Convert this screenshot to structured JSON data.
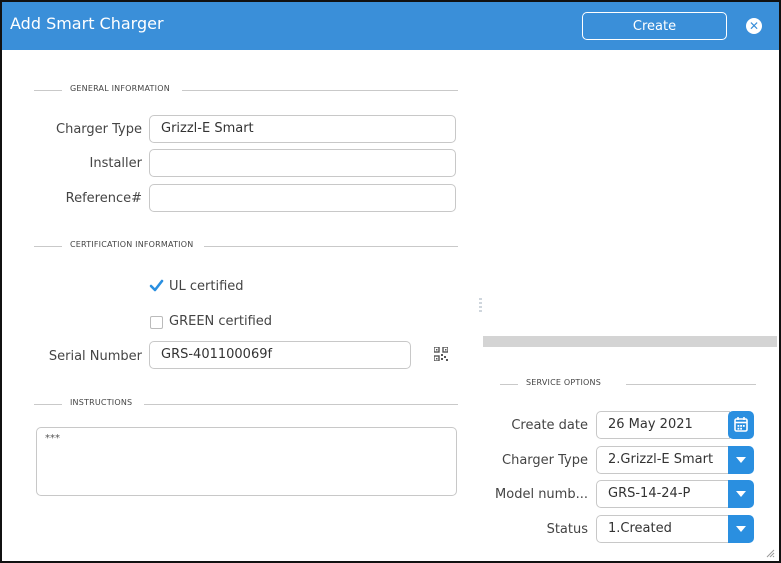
{
  "window": {
    "title": "Add Smart Charger",
    "create_label": "Create",
    "close_icon": "close-circle-icon"
  },
  "general": {
    "heading": "GENERAL INFORMATION",
    "charger_type_label": "Charger Type",
    "charger_type_value": "Grizzl-E Smart",
    "installer_label": "Installer",
    "installer_value": "",
    "reference_label": "Reference#",
    "reference_value": ""
  },
  "certification": {
    "heading": "CERTIFICATION INFORMATION",
    "ul_label": "UL certified",
    "ul_checked": true,
    "green_label": "GREEN certified",
    "green_checked": false,
    "serial_label": "Serial Number",
    "serial_value": "GRS-401100069f"
  },
  "instructions": {
    "heading": "INSTRUCTIONS",
    "value": "***"
  },
  "service": {
    "heading": "SERVICE OPTIONS",
    "create_date_label": "Create date",
    "create_date_value": "26 May 2021",
    "charger_type_label": "Charger Type",
    "charger_type_value": "2.Grizzl-E Smart",
    "model_label": "Model numb...",
    "model_value": "GRS-14-24-P",
    "status_label": "Status",
    "status_value": "1.Created"
  },
  "colors": {
    "accent": "#3a8fd9",
    "button": "#2a8fe0"
  }
}
